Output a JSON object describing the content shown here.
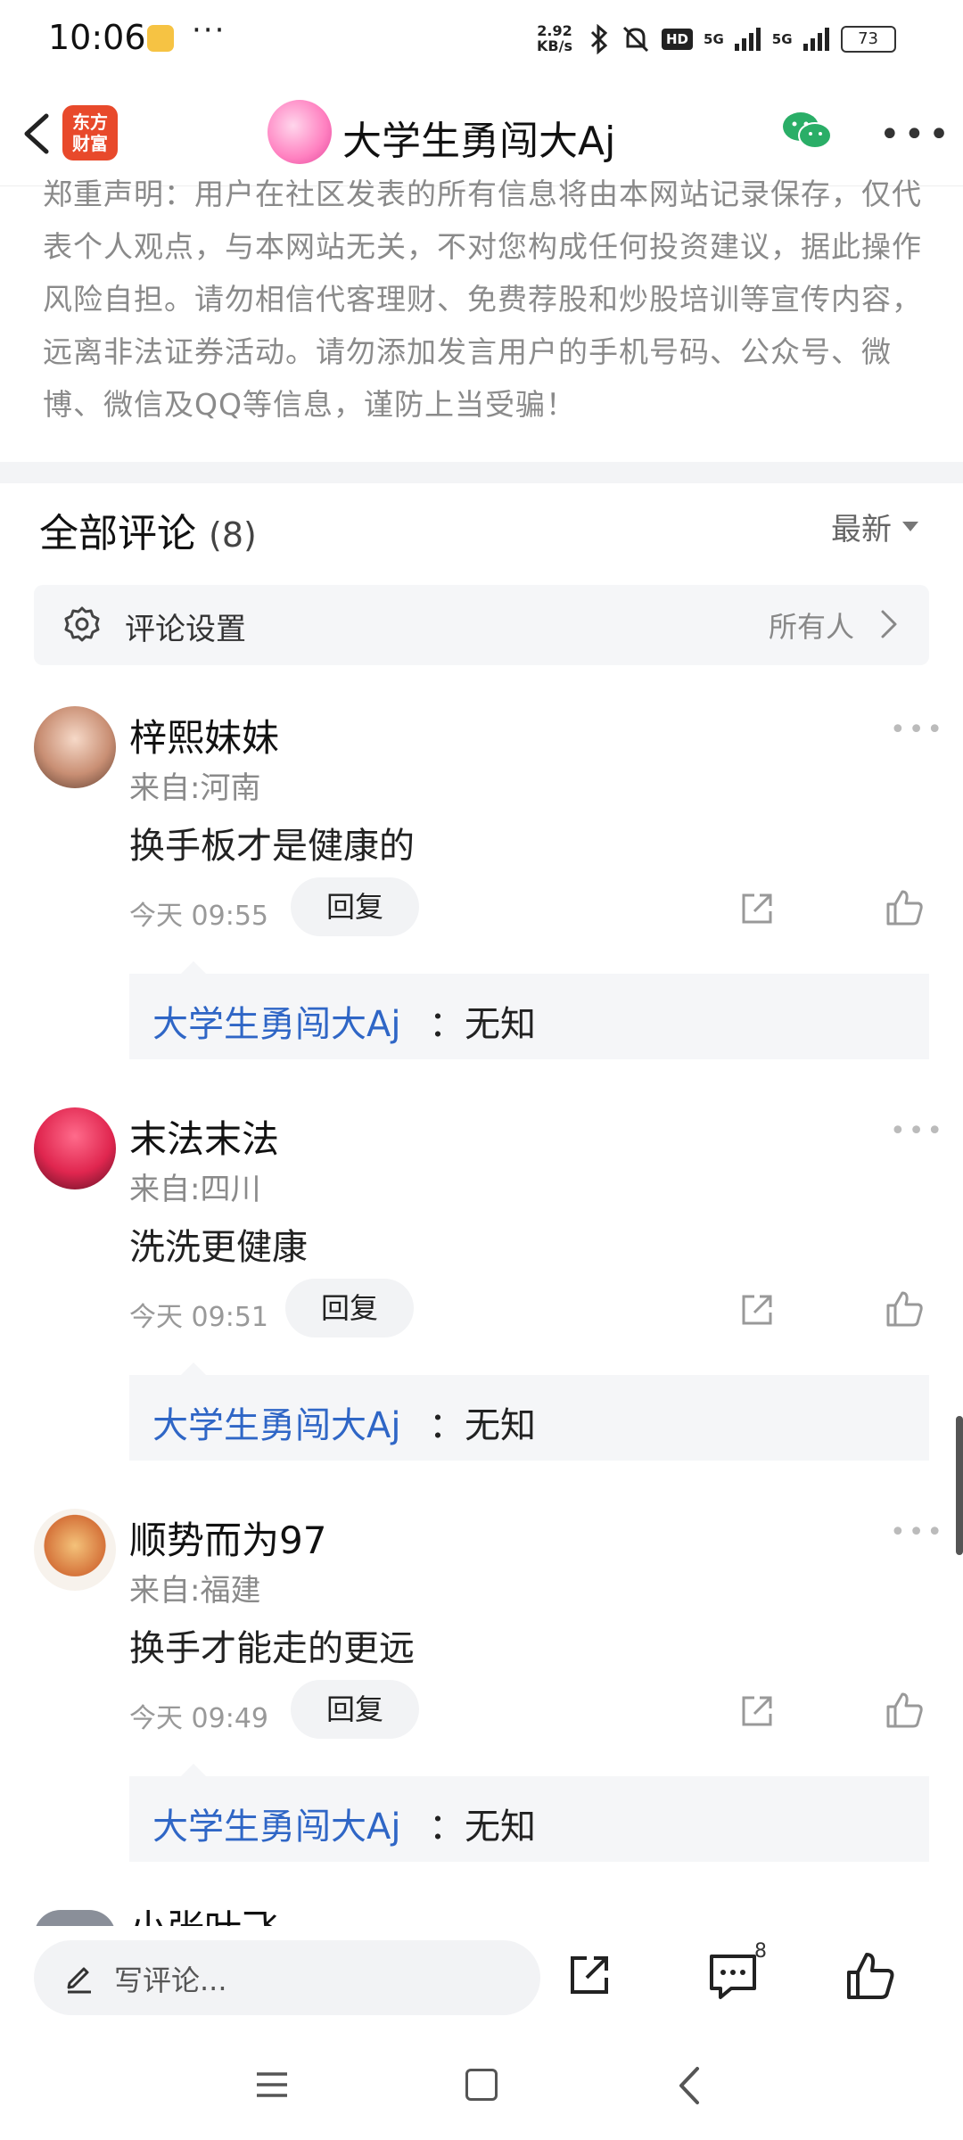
{
  "status_bar": {
    "time": "10:06",
    "dots": "···",
    "speed_value": "2.92",
    "speed_unit": "KB/s",
    "hd": "HD",
    "net1": "5G",
    "net2": "5G",
    "battery": "73"
  },
  "header": {
    "brand_line1": "东方",
    "brand_line2": "财富",
    "title": "大学生勇闯大Aj"
  },
  "disclaimer": "郑重声明：用户在社区发表的所有信息将由本网站记录保存，仅代表个人观点，与本网站无关，不对您构成任何投资建议，据此操作风险自担。请勿相信代客理财、免费荐股和炒股培训等宣传内容，远离非法证券活动。请勿添加发言用户的手机号码、公众号、微博、微信及QQ等信息，谨防上当受骗！",
  "comments_section": {
    "title": "全部评论",
    "count": "(8)",
    "sort_label": "最新",
    "settings_label": "评论设置",
    "settings_value": "所有人"
  },
  "comments": [
    {
      "name": "梓熙妹妹",
      "location": "来自:河南",
      "text": "换手板才是健康的",
      "time": "今天 09:55",
      "reply_label": "回复",
      "reply_author": "大学生勇闯大Aj",
      "reply_text": "：无知"
    },
    {
      "name": "末法末法",
      "location": "来自:四川",
      "text": "洗洗更健康",
      "time": "今天 09:51",
      "reply_label": "回复",
      "reply_author": "大学生勇闯大Aj",
      "reply_text": "：无知"
    },
    {
      "name": "顺势而为97",
      "location": "来自:福建",
      "text": "换手才能走的更远",
      "time": "今天 09:49",
      "reply_label": "回复",
      "reply_author": "大学生勇闯大Aj",
      "reply_text": "：无知"
    }
  ],
  "partial_comment_name": "小张叶飞",
  "bottom_bar": {
    "placeholder": "写评论...",
    "comment_count": "8"
  },
  "icons": {
    "back": "chevron-left-icon",
    "wechat": "wechat-icon",
    "more": "more-horizontal-icon",
    "gear": "gear-icon",
    "share": "share-icon",
    "like": "thumbs-up-icon",
    "comment": "comment-icon",
    "pencil": "pencil-icon"
  },
  "colors": {
    "brand_red": "#e8492b",
    "reply_author_blue": "#2f66c6",
    "wechat_green": "#2aae67"
  }
}
